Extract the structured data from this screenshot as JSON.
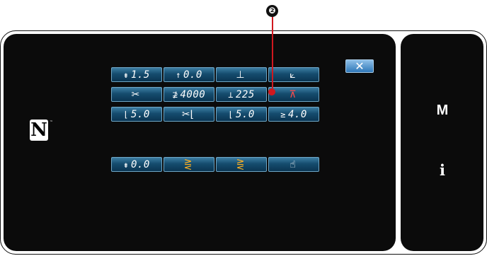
{
  "callout": {
    "number": "❷"
  },
  "close_button": {
    "label": "✕"
  },
  "nfc": {
    "logo": "N",
    "tm": "™"
  },
  "side": {
    "menu_label": "M",
    "info_label": "i"
  },
  "buttons": [
    {
      "id": "b1",
      "icon": "⇟",
      "value": "1.5"
    },
    {
      "id": "b2",
      "icon": "↑",
      "value": "0.0"
    },
    {
      "id": "b3",
      "icon": "⊥",
      "value": ""
    },
    {
      "id": "b4",
      "icon": "⟀",
      "value": ""
    },
    {
      "id": "b5",
      "icon": "✂",
      "value": ""
    },
    {
      "id": "b6",
      "icon": "⊉",
      "value": "4000"
    },
    {
      "id": "b7",
      "icon": "⊥",
      "value": "225"
    },
    {
      "id": "b8",
      "icon": "⊼",
      "value": ""
    },
    {
      "id": "b9",
      "icon": "⌊",
      "value": "5.0"
    },
    {
      "id": "b10",
      "icon": "✂⌊",
      "value": ""
    },
    {
      "id": "b11",
      "icon": "⌊",
      "value": "5.0"
    },
    {
      "id": "b12",
      "icon": "≥",
      "value": "4.0"
    },
    {
      "id": "b13",
      "icon": "⇟",
      "value": "0.0"
    },
    {
      "id": "b14",
      "icon": "⋛",
      "value": ""
    },
    {
      "id": "b15",
      "icon": "⋛",
      "value": ""
    },
    {
      "id": "b16",
      "icon": "☝",
      "value": ""
    }
  ]
}
